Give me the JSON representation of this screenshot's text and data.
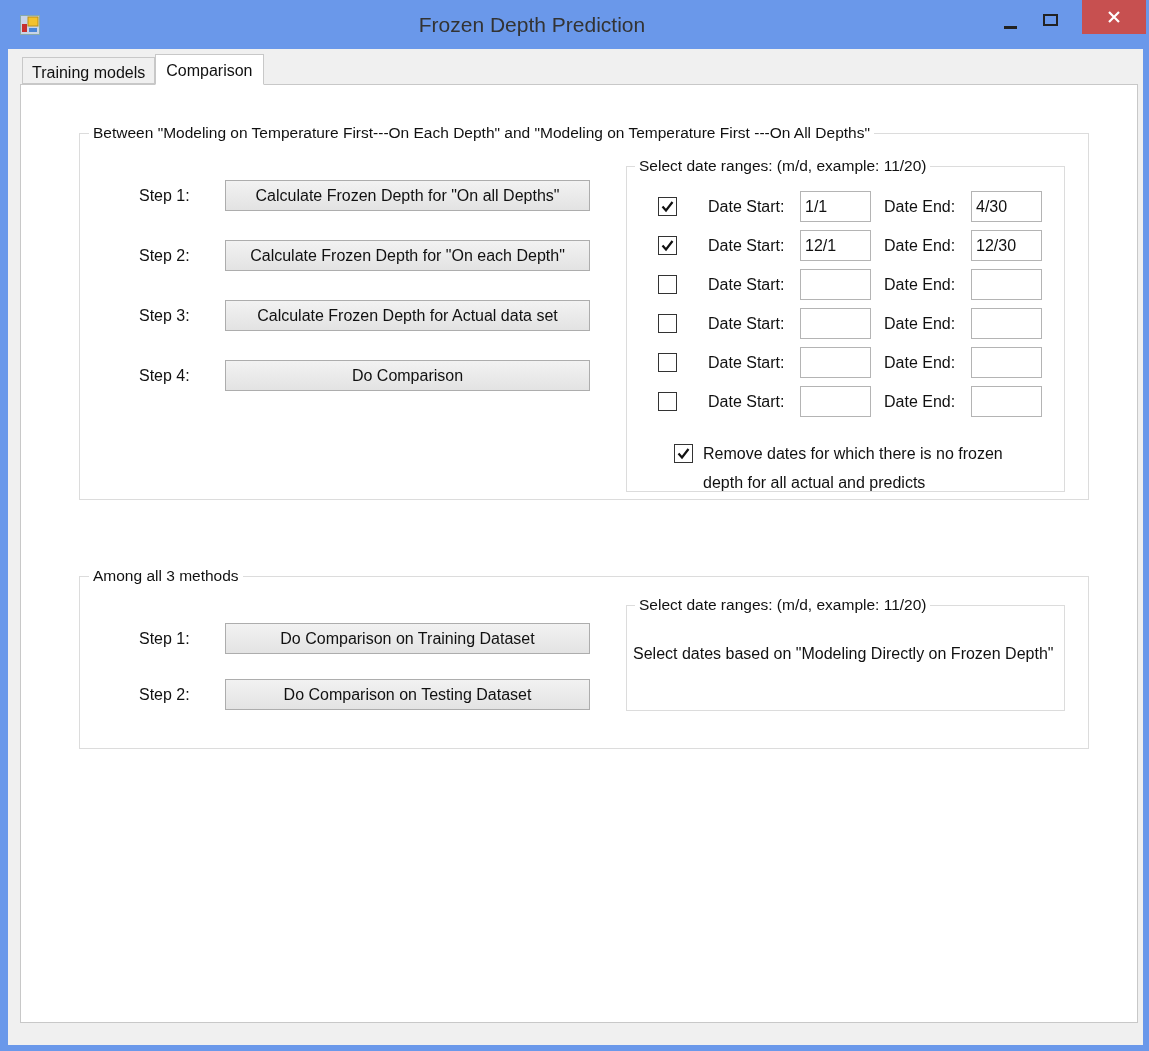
{
  "window": {
    "title": "Frozen Depth Prediction"
  },
  "tabs": [
    {
      "label": "Training models",
      "selected": false
    },
    {
      "label": "Comparison",
      "selected": true
    }
  ],
  "groups": [
    {
      "title": "Between \"Modeling on Temperature First---On Each Depth\" and \"Modeling on Temperature First ---On All Depths\"",
      "steps": [
        {
          "label": "Step 1:",
          "button": "Calculate Frozen Depth for \"On all Depths\""
        },
        {
          "label": "Step 2:",
          "button": "Calculate Frozen Depth for \"On each Depth\""
        },
        {
          "label": "Step 3:",
          "button": "Calculate Frozen Depth for Actual data set"
        },
        {
          "label": "Step 4:",
          "button": "Do Comparison"
        }
      ],
      "date_panel": {
        "title": "Select date ranges: (m/d, example: 11/20)",
        "rows": [
          {
            "checked": true,
            "start_label": "Date Start:",
            "start": "1/1",
            "end_label": "Date End:",
            "end": "4/30"
          },
          {
            "checked": true,
            "start_label": "Date Start:",
            "start": "12/1",
            "end_label": "Date End:",
            "end": "12/30"
          },
          {
            "checked": false,
            "start_label": "Date Start:",
            "end_label": "Date End:"
          },
          {
            "checked": false,
            "start_label": "Date Start:",
            "end_label": "Date End:"
          },
          {
            "checked": false,
            "start_label": "Date Start:",
            "end_label": "Date End:"
          },
          {
            "checked": false,
            "start_label": "Date Start:",
            "end_label": "Date End:"
          }
        ],
        "remove_option": {
          "checked": true,
          "label": "Remove dates for which there is no frozen depth for all actual and predicts"
        }
      }
    },
    {
      "title": "Among all 3 methods",
      "steps": [
        {
          "label": "Step 1:",
          "button": "Do Comparison on Training Dataset"
        },
        {
          "label": "Step 2:",
          "button": "Do Comparison on Testing Dataset"
        }
      ],
      "date_panel": {
        "title": "Select date ranges: (m/d, example: 11/20)",
        "note": "Select dates based on \"Modeling Directly on Frozen Depth\""
      }
    }
  ]
}
